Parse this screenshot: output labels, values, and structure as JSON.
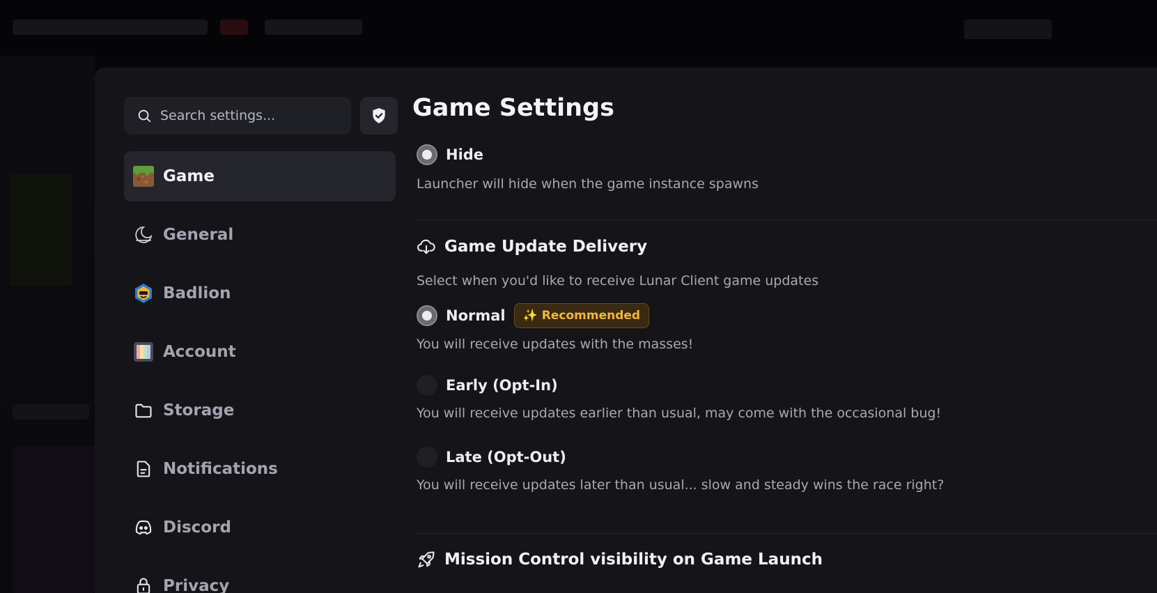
{
  "search": {
    "placeholder": "Search settings..."
  },
  "nav": [
    {
      "label": "Game",
      "active": true
    },
    {
      "label": "General",
      "active": false
    },
    {
      "label": "Badlion",
      "active": false
    },
    {
      "label": "Account",
      "active": false
    },
    {
      "label": "Storage",
      "active": false
    },
    {
      "label": "Notifications",
      "active": false
    },
    {
      "label": "Discord",
      "active": false
    },
    {
      "label": "Privacy",
      "active": false
    }
  ],
  "page": {
    "title": "Game Settings"
  },
  "launcher_visibility": {
    "option_label": "Hide",
    "option_selected": true,
    "option_desc": "Launcher will hide when the game instance spawns"
  },
  "update_delivery": {
    "title": "Game Update Delivery",
    "description": "Select when you'd like to receive Lunar Client game updates",
    "badge": "Recommended",
    "options": [
      {
        "label": "Normal",
        "selected": true,
        "desc": "You will receive updates with the masses!"
      },
      {
        "label": "Early (Opt-In)",
        "selected": false,
        "desc": "You will receive updates earlier than usual, may come with the occasional bug!"
      },
      {
        "label": "Late (Opt-Out)",
        "selected": false,
        "desc": "You will receive updates later than usual... slow and steady wins the race right?"
      }
    ]
  },
  "mission_control": {
    "title": "Mission Control visibility on Game Launch"
  },
  "colors": {
    "badge_text": "#f4b63f",
    "modal_bg": "#141419",
    "active_nav": "#25252e"
  }
}
